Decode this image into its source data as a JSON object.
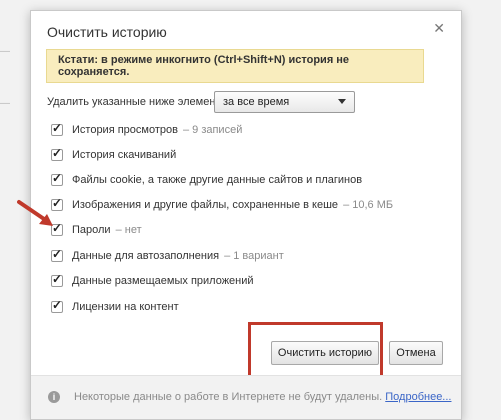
{
  "dialog": {
    "title": "Очистить историю",
    "close_icon": "close-icon",
    "notice": "Кстати: в режиме инкогнито (Ctrl+Shift+N) история не сохраняется.",
    "range_label": "Удалить указанные ниже элементы",
    "range_value": "за все время",
    "options": [
      {
        "label": "История просмотров",
        "extra": "– 9 записей",
        "checked": true
      },
      {
        "label": "История скачиваний",
        "extra": "",
        "checked": true
      },
      {
        "label": "Файлы cookie, а также другие данные сайтов и плагинов",
        "extra": "",
        "checked": true
      },
      {
        "label": "Изображения и другие файлы, сохраненные в кеше",
        "extra": "– 10,6 МБ",
        "checked": true
      },
      {
        "label": "Пароли",
        "extra": "– нет",
        "checked": true
      },
      {
        "label": "Данные для автозаполнения",
        "extra": "– 1 вариант",
        "checked": true
      },
      {
        "label": "Данные размещаемых приложений",
        "extra": "",
        "checked": true
      },
      {
        "label": "Лицензии на контент",
        "extra": "",
        "checked": true
      }
    ],
    "clear_button": "Очистить историю",
    "cancel_button": "Отмена",
    "footer_text": "Некоторые данные о работе в Интернете не будут удалены.",
    "footer_link": "Подробнее..."
  },
  "colors": {
    "notice_bg": "#f9edbe",
    "annotation_red": "#c0392b",
    "link": "#3a65c7"
  }
}
